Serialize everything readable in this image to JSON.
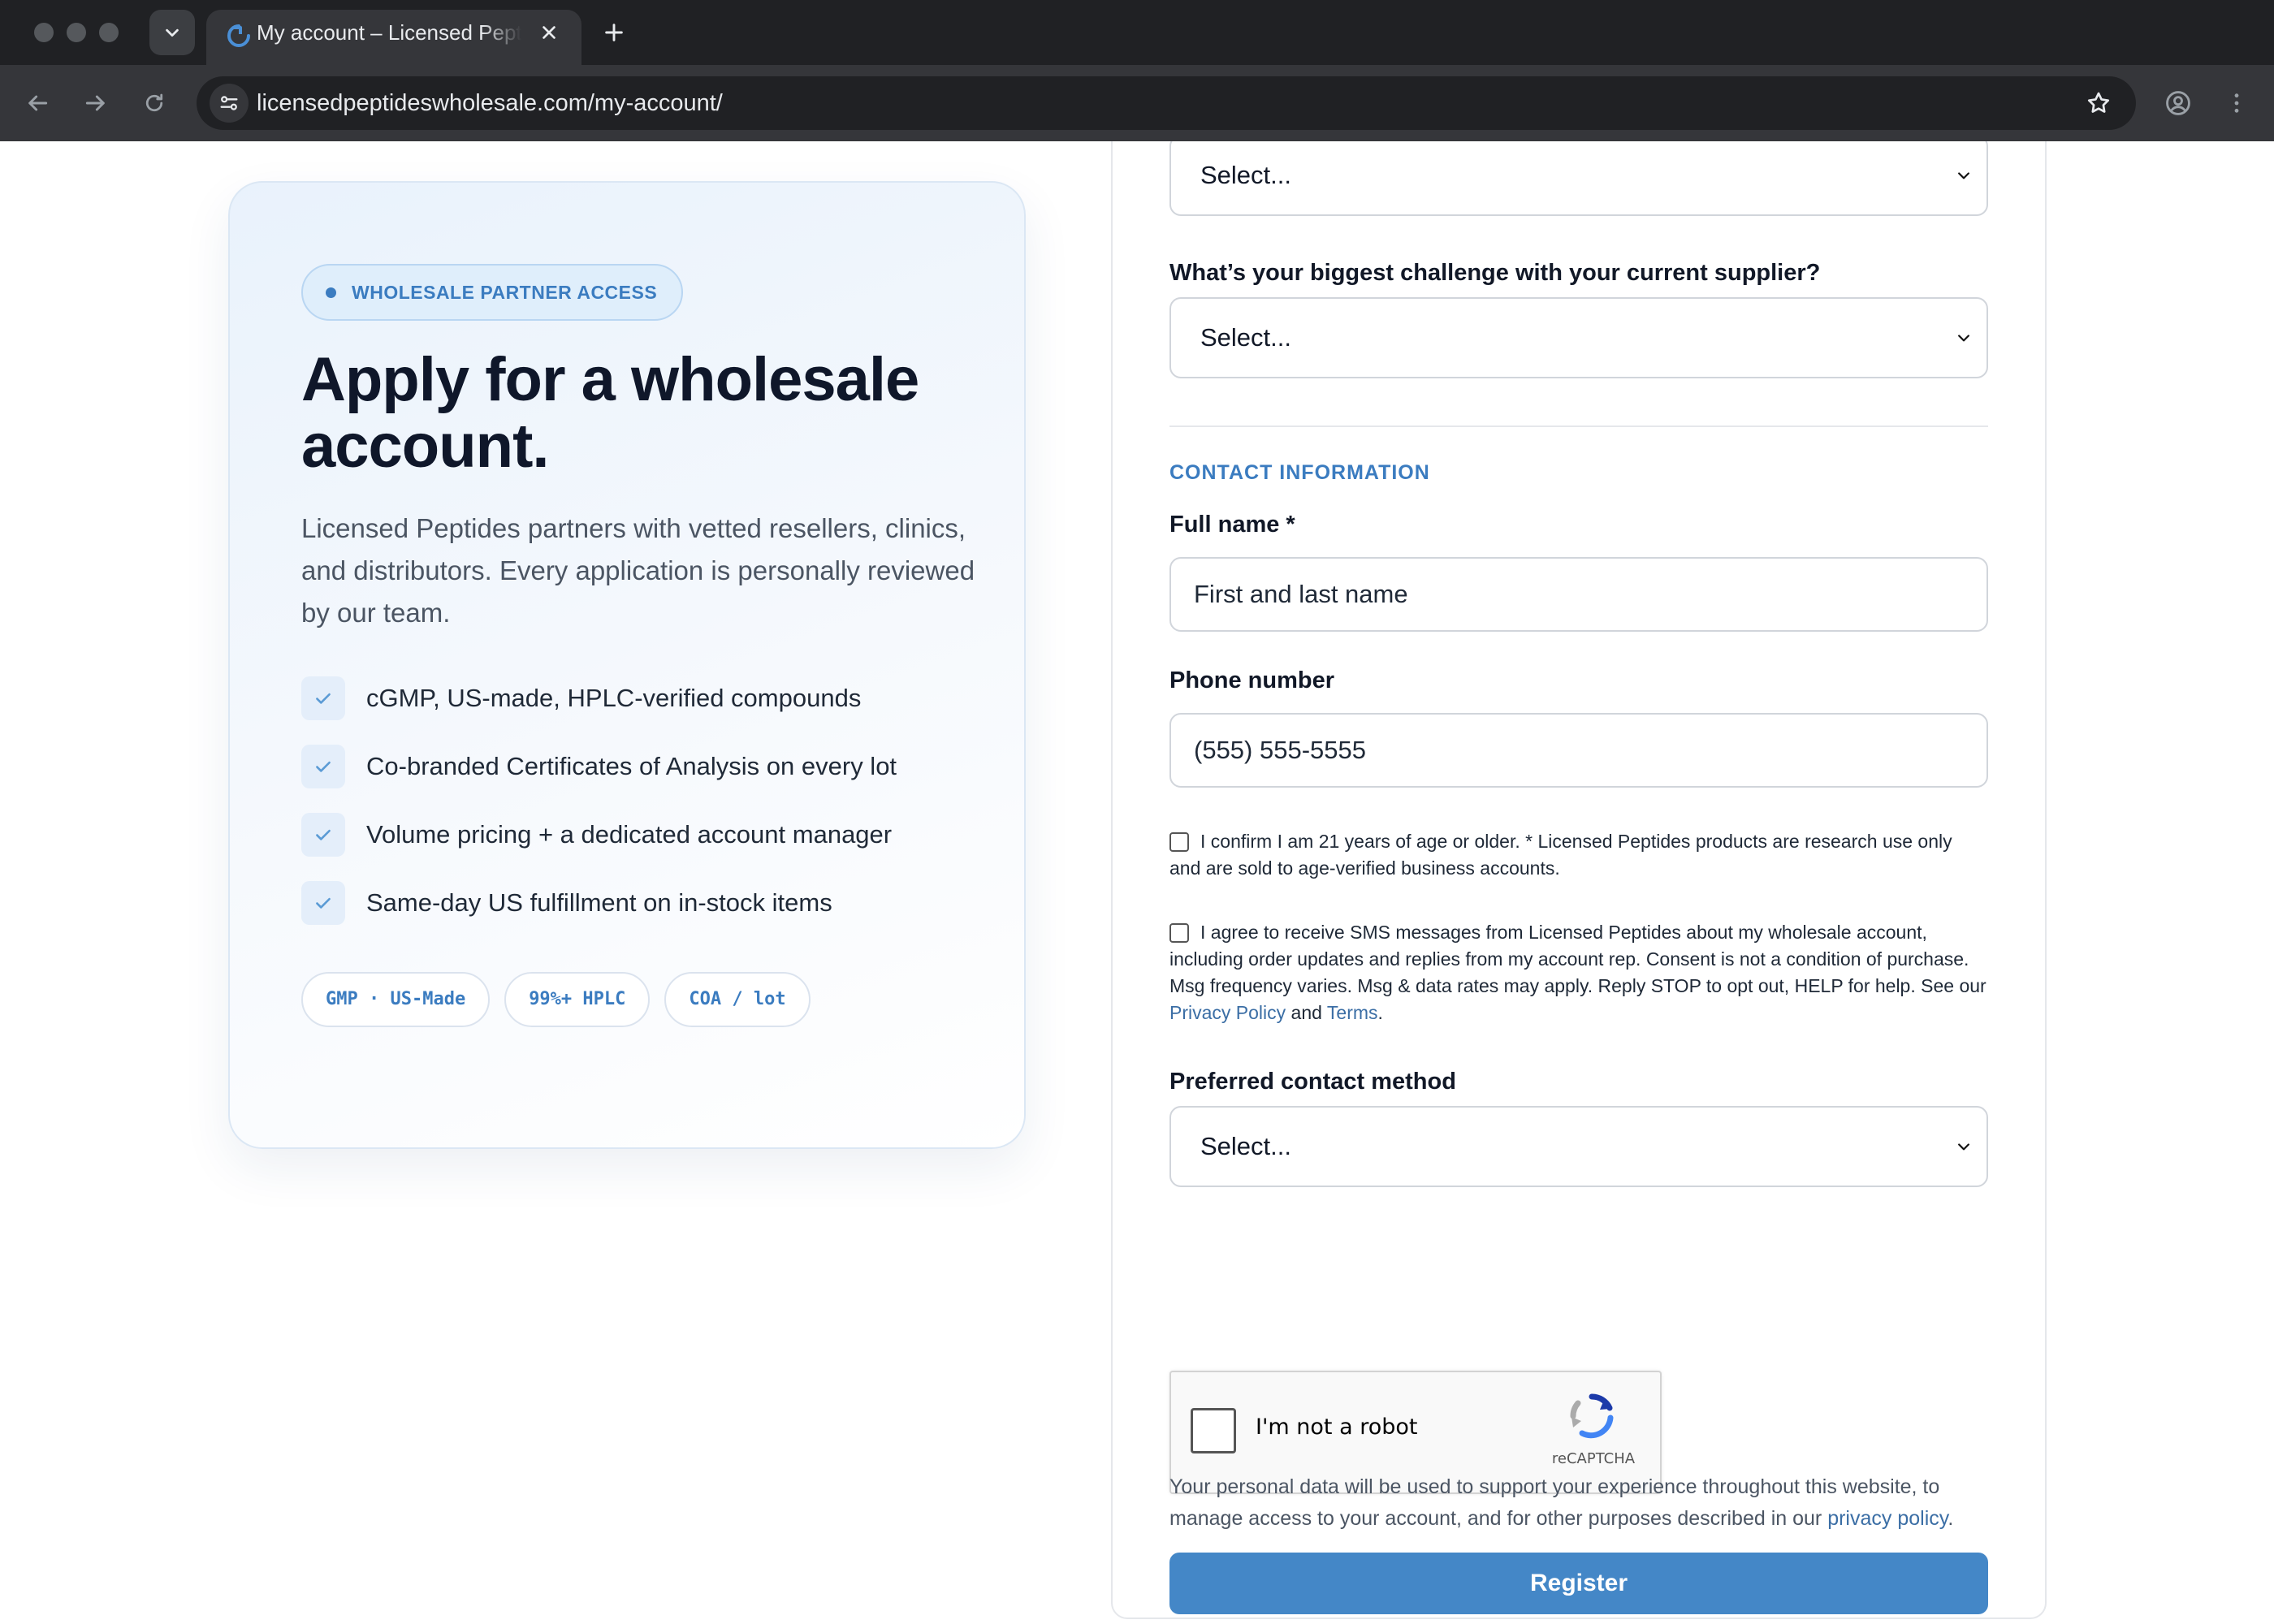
{
  "browser": {
    "tab_title": "My account – Licensed Peptides Wholesale",
    "url": "licensedpeptideswholesale.com/my-account/"
  },
  "hero": {
    "badge": "WHOLESALE PARTNER ACCESS",
    "title": "Apply for a wholesale account.",
    "description": "Licensed Peptides partners with vetted resellers, clinics, and distributors. Every application is personally reviewed by our team.",
    "features": [
      "cGMP, US-made, HPLC-verified compounds",
      "Co-branded Certificates of Analysis on every lot",
      "Volume pricing + a dedicated account manager",
      "Same-day US fulfillment on in-stock items"
    ],
    "pills": [
      "GMP · US-Made",
      "99%+ HPLC",
      "COA / lot"
    ]
  },
  "form": {
    "top_select_value": "Select...",
    "challenge_label": "What’s your biggest challenge with your current supplier?",
    "challenge_value": "Select...",
    "contact_heading": "CONTACT INFORMATION",
    "full_name_label": "Full name *",
    "full_name_placeholder": "First and last name",
    "phone_label": "Phone number",
    "phone_placeholder": "(555) 555-5555",
    "age_consent": "I confirm I am 21 years of age or older. * Licensed Peptides products are research use only and are sold to age-verified business accounts.",
    "sms_consent_text": "I agree to receive SMS messages from Licensed Peptides about my wholesale account, including order updates and replies from my account rep. Consent is not a condition of purchase. Msg frequency varies. Msg & data rates may apply. Reply STOP to opt out, HELP for help. See our",
    "sms_privacy_link": "Privacy Policy",
    "sms_and": "and",
    "sms_terms_link": "Terms",
    "sms_end": ".",
    "contact_method_label": "Preferred contact method",
    "contact_method_value": "Select...",
    "recaptcha_label": "I'm not a robot",
    "recaptcha_brand": "reCAPTCHA",
    "privacy_text": "Your personal data will be used to support your experience throughout this website, to manage access to your account, and for other purposes described in our",
    "privacy_link": "privacy policy",
    "privacy_end": ".",
    "register_label": "Register"
  },
  "colors": {
    "accent": "#3b7cc0",
    "register_button": "#4487c7",
    "chrome_dark": "#202124",
    "chrome_toolbar": "#35363a"
  },
  "icons": [
    "chevron-down-icon",
    "close-icon",
    "plus-icon",
    "back-arrow-icon",
    "forward-arrow-icon",
    "reload-icon",
    "site-info-icon",
    "star-icon",
    "profile-icon",
    "more-menu-icon",
    "check-icon",
    "recaptcha-logo-icon"
  ]
}
